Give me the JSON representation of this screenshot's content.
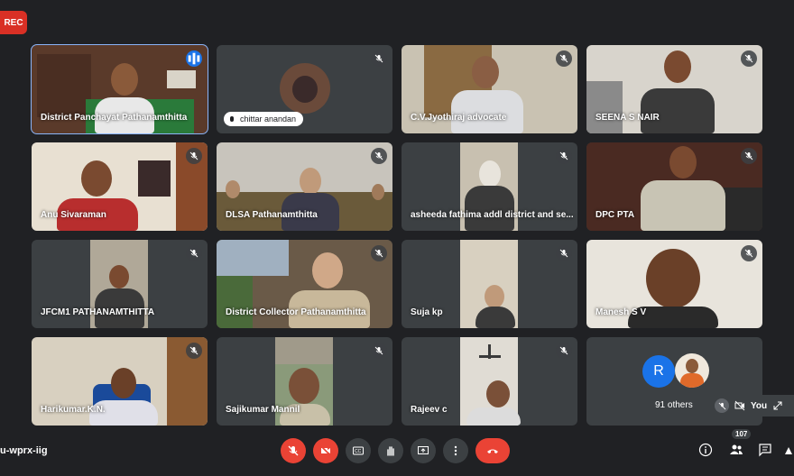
{
  "recording": {
    "label": "REC"
  },
  "meeting": {
    "code": "u-wprx-iig"
  },
  "participants": [
    {
      "name": "District Panchayat Pathanamthitta",
      "muted": false
    },
    {
      "name": "chittar anandan",
      "muted": true
    },
    {
      "name": "C.V.Jyothiraj advocate",
      "muted": true
    },
    {
      "name": "SEENA S NAIR",
      "muted": true
    },
    {
      "name": "Anu Sivaraman",
      "muted": true
    },
    {
      "name": "DLSA Pathanamthitta",
      "muted": true
    },
    {
      "name": "asheeda fathima addl district and se...",
      "muted": true
    },
    {
      "name": "DPC PTA",
      "muted": true
    },
    {
      "name": "JFCM1 PATHANAMTHITTA",
      "muted": true
    },
    {
      "name": "District Collector Pathanamthitta",
      "muted": true
    },
    {
      "name": "Suja kp",
      "muted": true
    },
    {
      "name": "Manesh S V",
      "muted": true
    },
    {
      "name": "Harikumar.K.N.",
      "muted": true
    },
    {
      "name": "Sajikumar Mannil",
      "muted": true
    },
    {
      "name": "Rajeev c",
      "muted": true
    }
  ],
  "others": {
    "label": "91 others",
    "avatar_initial": "R",
    "avatar_color": "#1a73e8"
  },
  "self_view": {
    "label": "You"
  },
  "people": {
    "count": "107"
  },
  "colors": {
    "background": "#202124",
    "tile": "#3c4043",
    "danger": "#ea4335",
    "accent": "#8ab4f8"
  }
}
